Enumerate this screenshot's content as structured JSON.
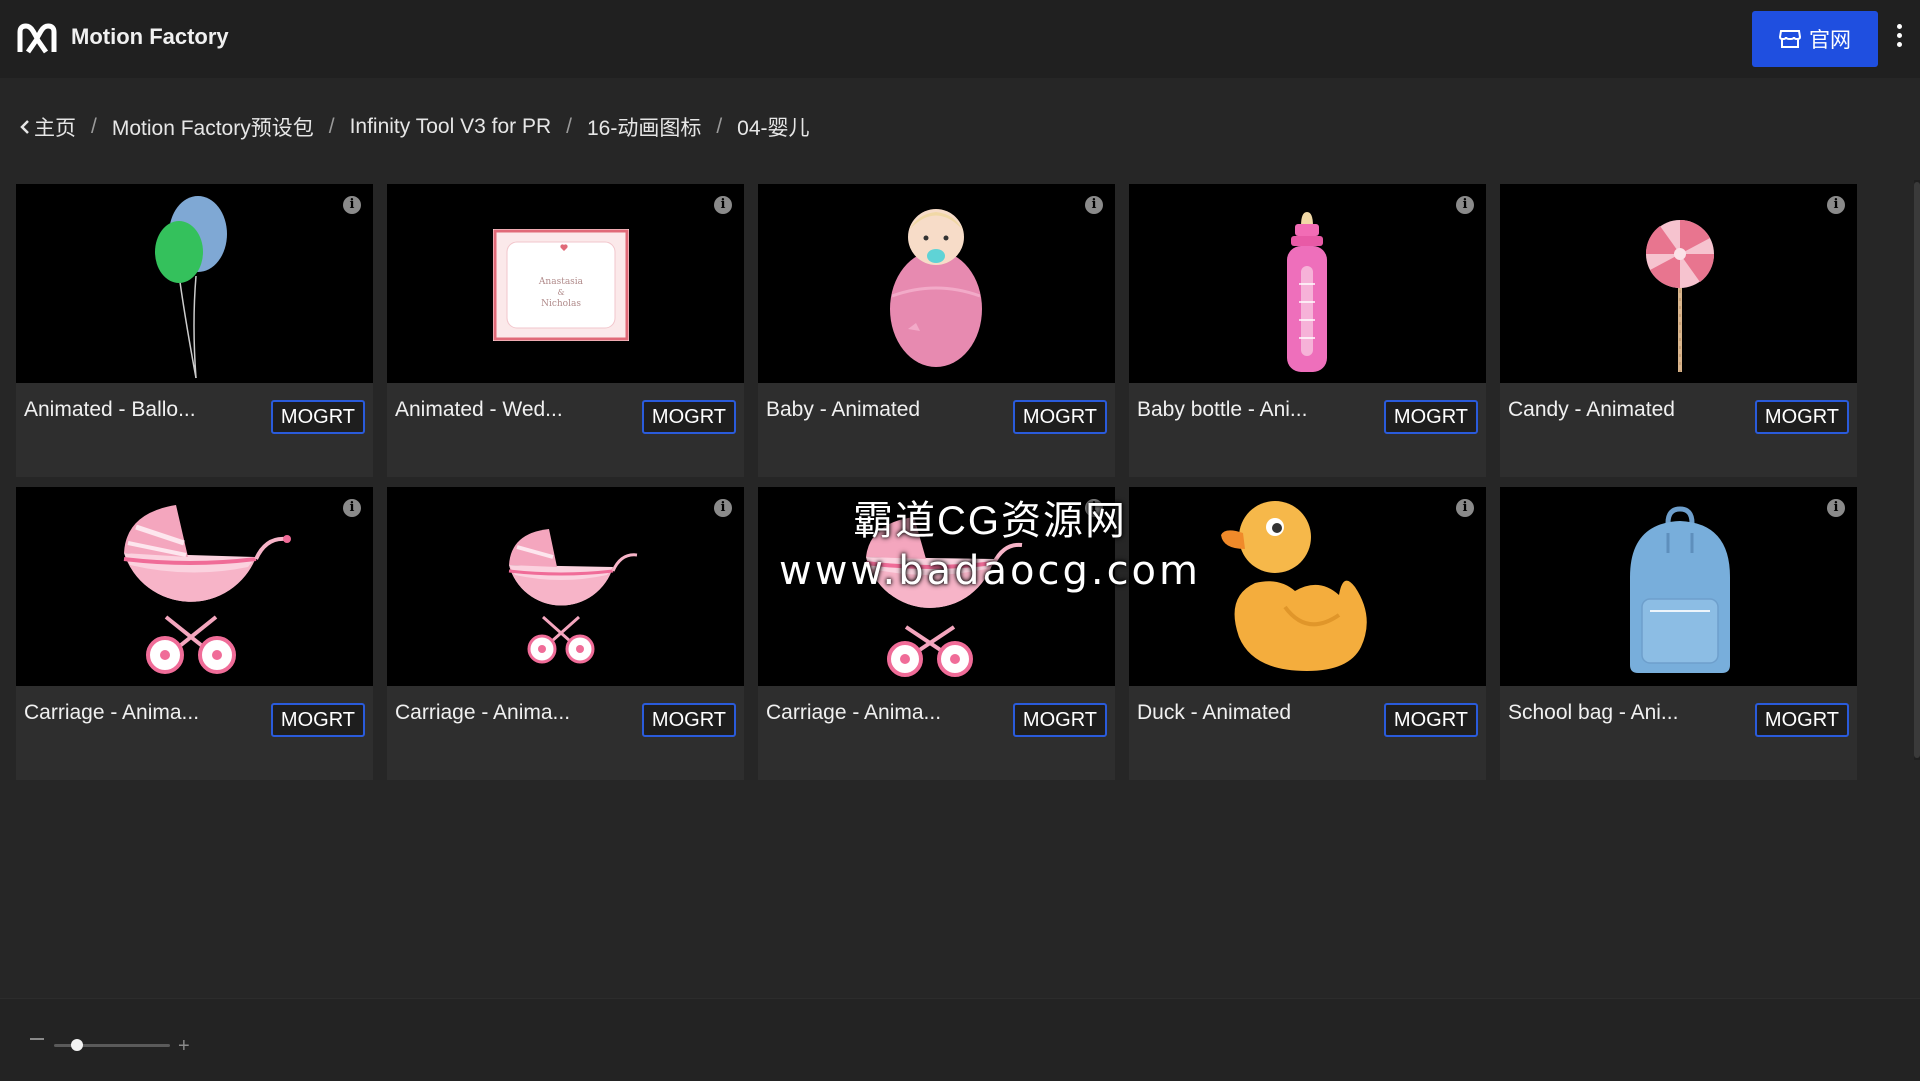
{
  "app": {
    "title": "Motion Factory"
  },
  "header": {
    "site_button_label": "官网",
    "site_icon": "store-icon"
  },
  "breadcrumb": {
    "items": [
      "主页",
      "Motion Factory预设包",
      "Infinity Tool V3 for PR",
      "16-动画图标",
      "04-婴儿"
    ],
    "separator": "/"
  },
  "cards": [
    {
      "title": "Animated - Ballo...",
      "tag": "MOGRT"
    },
    {
      "title": "Animated - Wed...",
      "tag": "MOGRT"
    },
    {
      "title": "Baby - Animated",
      "tag": "MOGRT"
    },
    {
      "title": "Baby bottle - Ani...",
      "tag": "MOGRT"
    },
    {
      "title": "Candy - Animated",
      "tag": "MOGRT"
    },
    {
      "title": "Carriage - Anima...",
      "tag": "MOGRT"
    },
    {
      "title": "Carriage - Anima...",
      "tag": "MOGRT"
    },
    {
      "title": "Carriage - Anima...",
      "tag": "MOGRT"
    },
    {
      "title": "Duck - Animated",
      "tag": "MOGRT"
    },
    {
      "title": "School bag - Ani...",
      "tag": "MOGRT"
    }
  ],
  "card_extra": {
    "wedding_card_text": [
      "Anastasia",
      "&",
      "Nicholas"
    ]
  },
  "info_glyph": "i",
  "watermark": {
    "line1": "霸道CG资源网",
    "line2": "www.badaocg.com"
  },
  "zoom": {
    "minus": "−",
    "plus": "+",
    "level": 0.2
  },
  "colors": {
    "accent": "#1f4fe0",
    "tag_border": "#2a5bdb",
    "background": "#262626"
  }
}
